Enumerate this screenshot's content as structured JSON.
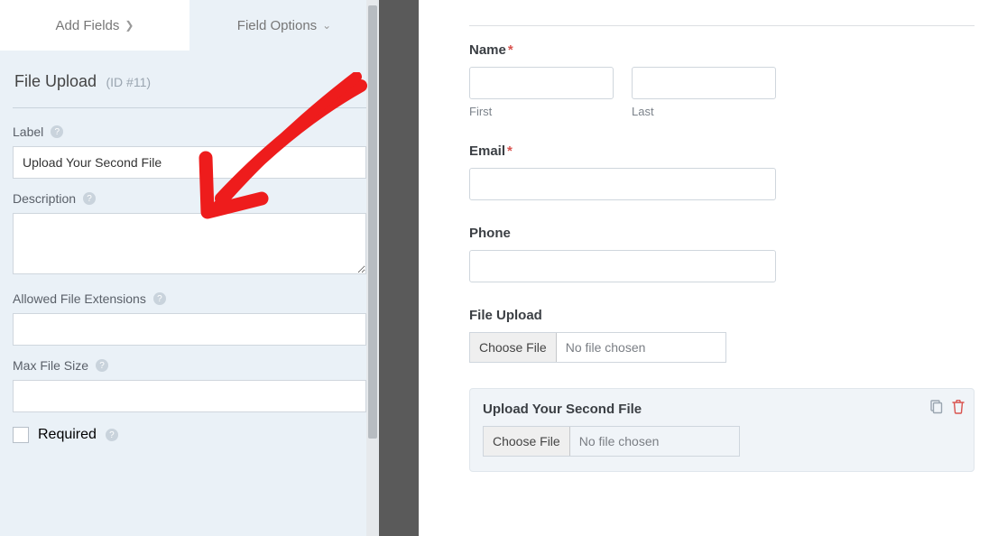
{
  "tabs": {
    "add_fields": "Add Fields",
    "field_options": "Field Options"
  },
  "section": {
    "title": "File Upload",
    "id_label": "(ID #11)"
  },
  "options": {
    "label_label": "Label",
    "label_value": "Upload Your Second File",
    "description_label": "Description",
    "description_value": "",
    "allowed_ext_label": "Allowed File Extensions",
    "allowed_ext_value": "",
    "max_size_label": "Max File Size",
    "max_size_value": "",
    "required_label": "Required"
  },
  "preview": {
    "name_label": "Name",
    "first_sub": "First",
    "last_sub": "Last",
    "email_label": "Email",
    "phone_label": "Phone",
    "file1_label": "File Upload",
    "file2_label": "Upload Your Second File",
    "choose_file": "Choose File",
    "no_file": "No file chosen"
  }
}
